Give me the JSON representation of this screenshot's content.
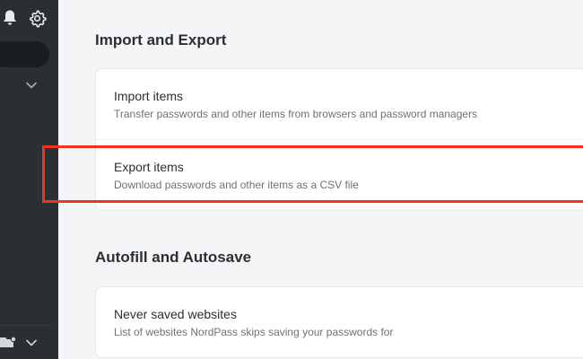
{
  "sidebar": {
    "icons": [
      "bell-icon",
      "gear-icon",
      "chevron-down-icon",
      "vault-icon",
      "chevron-down-icon"
    ]
  },
  "sections": [
    {
      "title": "Import and Export",
      "items": [
        {
          "title": "Import items",
          "description": "Transfer passwords and other items from browsers and password managers"
        },
        {
          "title": "Export items",
          "description": "Download passwords and other items as a CSV file"
        }
      ]
    },
    {
      "title": "Autofill and Autosave",
      "items": [
        {
          "title": "Never saved websites",
          "description": "List of websites NordPass skips saving your passwords for"
        }
      ]
    }
  ],
  "colors": {
    "sidebar_bg": "#2b2f33",
    "page_bg": "#f4f5f6",
    "highlight": "#f0331f"
  }
}
